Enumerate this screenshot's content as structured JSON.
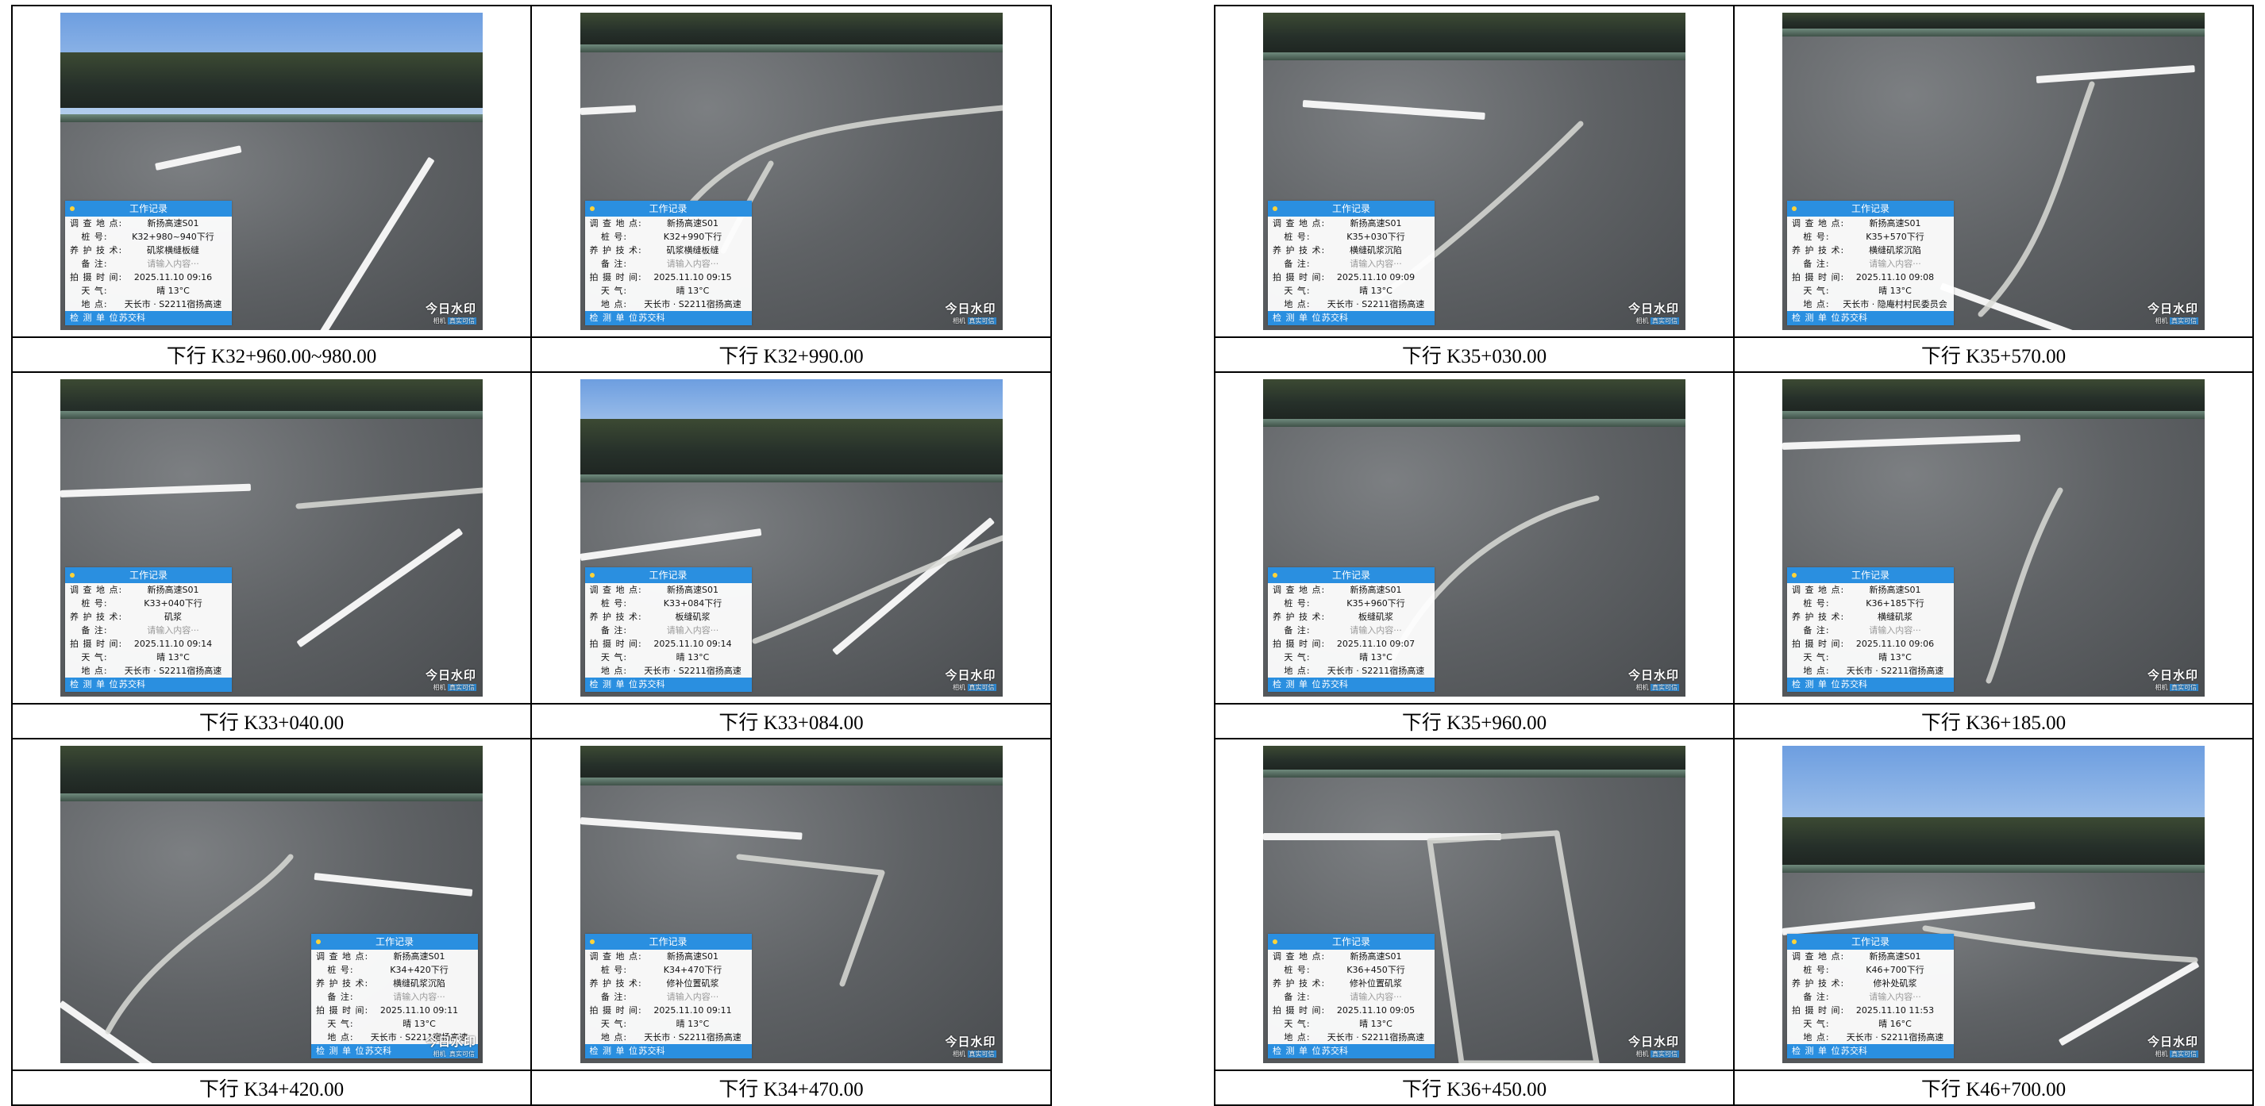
{
  "common": {
    "panel_title": "工作记录",
    "labels": {
      "location": "调 查 地 点:",
      "stake": "桩      号:",
      "technique": "养 护 技 术:",
      "remark": "备      注:",
      "time": "拍 摄 时 间:",
      "weather": "天      气:",
      "place": "地      点:",
      "unit": "检 测 单 位:"
    },
    "location_value": "新扬高速S01",
    "remark_placeholder": "请输入内容···",
    "place_value": "天长市 · S2211宿扬高速",
    "unit_value": "苏交科",
    "watermark_title": "今日水印",
    "watermark_sub_a": "相机",
    "watermark_sub_b": "真实可信"
  },
  "photos": [
    {
      "caption": "下行 K32+960.00~980.00",
      "stake": "K32+980~940下行",
      "technique": "矶浆横缝板缝",
      "time": "2025.11.10 09:16",
      "weather": "晴 13°C",
      "place": "天长市 · S2211宿扬高速"
    },
    {
      "caption": "下行 K32+990.00",
      "stake": "K32+990下行",
      "technique": "矶浆横缝板缝",
      "time": "2025.11.10 09:15",
      "weather": "晴 13°C",
      "place": "天长市 · S2211宿扬高速"
    },
    {
      "caption": "下行 K33+040.00",
      "stake": "K33+040下行",
      "technique": "矶浆",
      "time": "2025.11.10 09:14",
      "weather": "晴 13°C",
      "place": "天长市 · S2211宿扬高速"
    },
    {
      "caption": "下行 K33+084.00",
      "stake": "K33+084下行",
      "technique": "板缝矶浆",
      "time": "2025.11.10 09:14",
      "weather": "晴 13°C",
      "place": "天长市 · S2211宿扬高速"
    },
    {
      "caption": "下行 K34+420.00",
      "stake": "K34+420下行",
      "technique": "横缝矶浆沉陷",
      "time": "2025.11.10 09:11",
      "weather": "晴 13°C",
      "place": "天长市 · S2211宿扬高速"
    },
    {
      "caption": "下行 K34+470.00",
      "stake": "K34+470下行",
      "technique": "修补位置矶浆",
      "time": "2025.11.10 09:11",
      "weather": "晴 13°C",
      "place": "天长市 · S2211宿扬高速"
    },
    {
      "caption": "下行 K35+030.00",
      "stake": "K35+030下行",
      "technique": "横缝矶浆沉陷",
      "time": "2025.11.10 09:09",
      "weather": "晴 13°C",
      "place": "天长市 · S2211宿扬高速"
    },
    {
      "caption": "下行 K35+570.00",
      "stake": "K35+570下行",
      "technique": "横缝矶浆沉陷",
      "time": "2025.11.10 09:08",
      "weather": "晴 13°C",
      "place": "天长市 · 隐庵村村民委员会"
    },
    {
      "caption": "下行 K35+960.00",
      "stake": "K35+960下行",
      "technique": "板缝矶浆",
      "time": "2025.11.10 09:07",
      "weather": "晴 13°C",
      "place": "天长市 · S2211宿扬高速"
    },
    {
      "caption": "下行 K36+185.00",
      "stake": "K36+185下行",
      "technique": "横缝矶浆",
      "time": "2025.11.10 09:06",
      "weather": "晴 13°C",
      "place": "天长市 · S2211宿扬高速"
    },
    {
      "caption": "下行 K36+450.00",
      "stake": "K36+450下行",
      "technique": "修补位置矶浆",
      "time": "2025.11.10 09:05",
      "weather": "晴 13°C",
      "place": "天长市 · S2211宿扬高速"
    },
    {
      "caption": "下行 K46+700.00",
      "stake": "K46+700下行",
      "technique": "修补处矶浆",
      "time": "2025.11.10 11:53",
      "weather": "晴 16°C",
      "place": "天长市 · S2211宿扬高速"
    }
  ]
}
